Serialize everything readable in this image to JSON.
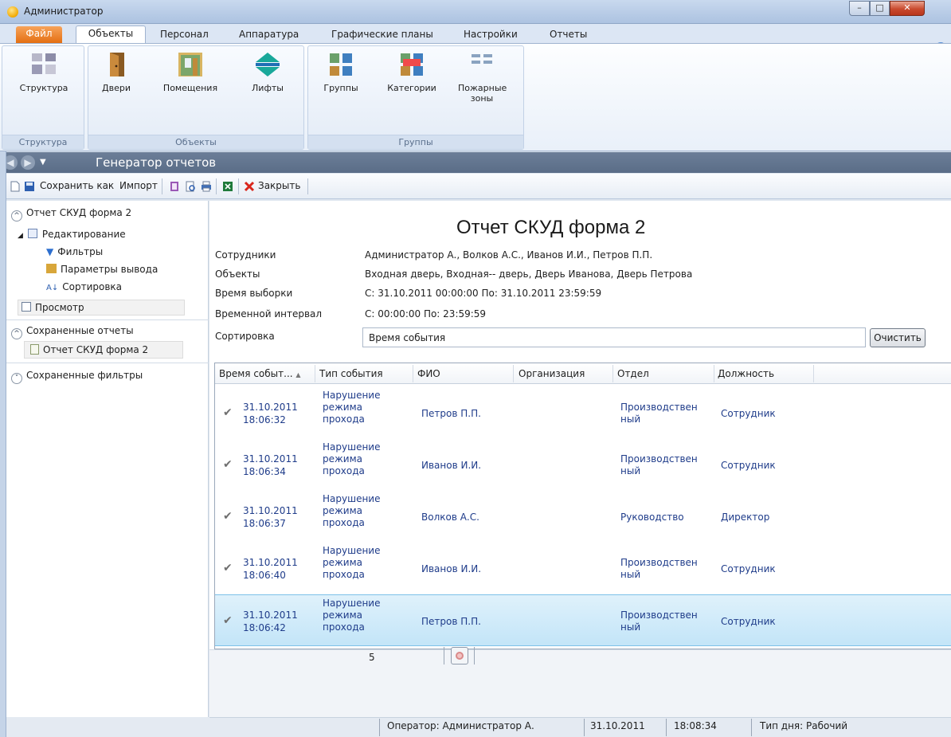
{
  "window": {
    "title": "Администратор"
  },
  "ribbon": {
    "tabs": [
      "Файл",
      "Объекты",
      "Персонал",
      "Аппаратура",
      "Графические планы",
      "Настройки",
      "Отчеты"
    ],
    "groups": {
      "structure": {
        "label": "Структура",
        "buttons": [
          "Структура"
        ]
      },
      "objects": {
        "label": "Объекты",
        "buttons": [
          "Двери",
          "Помещения",
          "Лифты"
        ]
      },
      "groups": {
        "label": "Группы",
        "buttons": [
          "Группы",
          "Категории",
          "Пожарные зоны"
        ]
      }
    }
  },
  "nav": {
    "title": "Генератор отчетов"
  },
  "toolbar": {
    "save_as": "Сохранить как",
    "import": "Импорт",
    "close": "Закрыть"
  },
  "left": {
    "report_header": "Отчет СКУД форма 2",
    "editing": "Редактирование",
    "filters": "Фильтры",
    "output_params": "Параметры вывода",
    "sorting": "Сортировка",
    "preview": "Просмотр",
    "saved_reports": "Сохраненные отчеты",
    "saved_report_item": "Отчет СКУД форма 2",
    "saved_filters": "Сохраненные фильтры"
  },
  "report": {
    "title": "Отчет СКУД форма 2",
    "params": [
      {
        "label": "Сотрудники",
        "value": "Администратор А., Волков А.С., Иванов И.И., Петров П.П."
      },
      {
        "label": "Объекты",
        "value": "Входная дверь, Входная-- дверь, Дверь Иванова, Дверь Петрова"
      },
      {
        "label": "Время выборки",
        "value": "С: 31.10.2011 00:00:00 По: 31.10.2011 23:59:59"
      },
      {
        "label": "Временной интервал",
        "value": "С: 00:00:00 По: 23:59:59"
      }
    ],
    "sort_label": "Сортировка",
    "sort_value": "Время события",
    "clear_button": "Очистить"
  },
  "table": {
    "columns": [
      "Время событ...",
      "Тип события",
      "ФИО",
      "Организация",
      "Отдел",
      "Должность"
    ],
    "rows": [
      {
        "date": "31.10.2011",
        "time": "18:06:32",
        "type": [
          "Нарушение",
          "режима",
          "прохода"
        ],
        "fio": "Петров П.П.",
        "org": "",
        "dept": [
          "Производствен",
          "ный"
        ],
        "position": "Сотрудник"
      },
      {
        "date": "31.10.2011",
        "time": "18:06:34",
        "type": [
          "Нарушение",
          "режима",
          "прохода"
        ],
        "fio": "Иванов И.И.",
        "org": "",
        "dept": [
          "Производствен",
          "ный"
        ],
        "position": "Сотрудник"
      },
      {
        "date": "31.10.2011",
        "time": "18:06:37",
        "type": [
          "Нарушение",
          "режима",
          "прохода"
        ],
        "fio": "Волков А.С.",
        "org": "",
        "dept": [
          "Руководство"
        ],
        "position": "Директор"
      },
      {
        "date": "31.10.2011",
        "time": "18:06:40",
        "type": [
          "Нарушение",
          "режима",
          "прохода"
        ],
        "fio": "Иванов И.И.",
        "org": "",
        "dept": [
          "Производствен",
          "ный"
        ],
        "position": "Сотрудник"
      },
      {
        "date": "31.10.2011",
        "time": "18:06:42",
        "type": [
          "Нарушение",
          "режима",
          "прохода"
        ],
        "fio": "Петров П.П.",
        "org": "",
        "dept": [
          "Производствен",
          "ный"
        ],
        "position": "Сотрудник"
      }
    ],
    "selected_row": 4,
    "count": "5"
  },
  "status": {
    "operator_label": "Оператор:",
    "operator": "Администратор А.",
    "date": "31.10.2011",
    "time": "18:08:34",
    "daytype_label": "Тип дня:",
    "daytype": "Рабочий"
  }
}
